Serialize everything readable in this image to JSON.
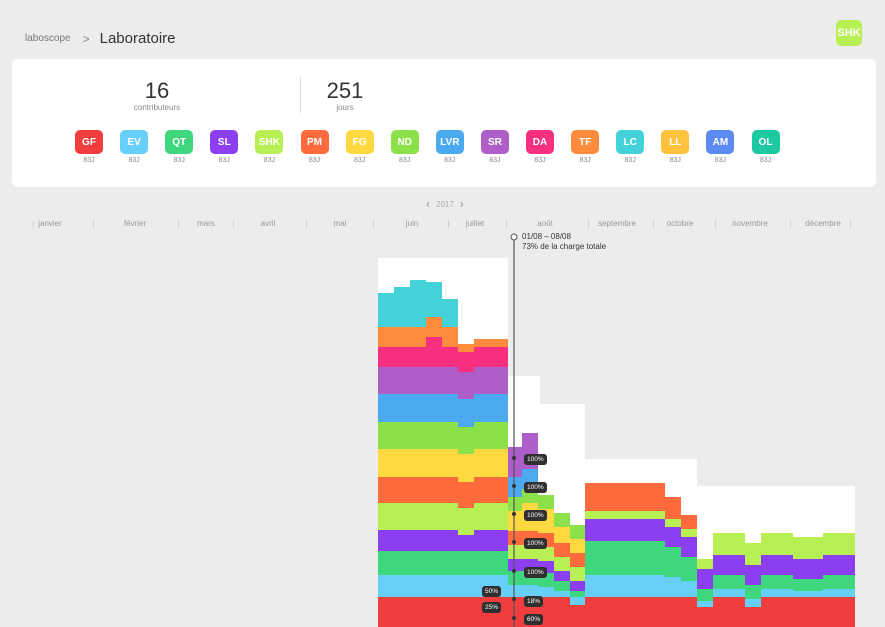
{
  "breadcrumb": {
    "root": "laboscope",
    "separator": ">",
    "current": "Laboratoire"
  },
  "user": {
    "initials": "SHK",
    "color": "#b8ef55"
  },
  "stats": [
    {
      "value": "16",
      "label": "contributeurs"
    },
    {
      "value": "251",
      "label": "jours"
    }
  ],
  "contributors": [
    {
      "initials": "GF",
      "days": "83J",
      "color": "#f03e3e"
    },
    {
      "initials": "EV",
      "days": "83J",
      "color": "#66d0fa"
    },
    {
      "initials": "QT",
      "days": "83J",
      "color": "#3fd77e"
    },
    {
      "initials": "SL",
      "days": "83J",
      "color": "#8b3ff0"
    },
    {
      "initials": "SHK",
      "days": "83J",
      "color": "#b8ef55"
    },
    {
      "initials": "PM",
      "days": "83J",
      "color": "#ff6b3d"
    },
    {
      "initials": "FG",
      "days": "83J",
      "color": "#ffd93f"
    },
    {
      "initials": "ND",
      "days": "83J",
      "color": "#8ce04a"
    },
    {
      "initials": "LVR",
      "days": "83J",
      "color": "#4aa9ef"
    },
    {
      "initials": "SR",
      "days": "83J",
      "color": "#ad5ec9"
    },
    {
      "initials": "DA",
      "days": "83J",
      "color": "#f72f80"
    },
    {
      "initials": "TF",
      "days": "83J",
      "color": "#ff8b3d"
    },
    {
      "initials": "LC",
      "days": "83J",
      "color": "#42d2d7"
    },
    {
      "initials": "LL",
      "days": "83J",
      "color": "#ffc23f"
    },
    {
      "initials": "AM",
      "days": "83J",
      "color": "#5b8bf2"
    },
    {
      "initials": "OL",
      "days": "83J",
      "color": "#1cc9a0"
    }
  ],
  "year_nav": {
    "year": "2017"
  },
  "months": [
    "janvier",
    "février",
    "mars",
    "avril",
    "mai",
    "juin",
    "juillet",
    "août",
    "septembre",
    "octobre",
    "novembre",
    "décembre"
  ],
  "selection": {
    "range": "01/08 – 08/08",
    "summary": "73% de la charge totale"
  },
  "chart_data": {
    "type": "area",
    "x": [
      "mai",
      "juin",
      "juillet",
      "août",
      "septembre",
      "octobre",
      "novembre",
      "décembre"
    ],
    "series_order": [
      "GF",
      "EV",
      "QT",
      "SL",
      "SHK",
      "PM",
      "FG",
      "ND",
      "LVR",
      "SR",
      "DA",
      "TF",
      "LC"
    ],
    "columns": [
      {
        "week": 1,
        "layers": [
          10,
          7,
          10,
          8,
          15,
          10,
          10,
          10,
          10,
          10,
          7,
          8,
          3,
          8
        ]
      },
      {
        "week": 2,
        "layers": [
          10,
          7,
          10,
          8,
          15,
          10,
          10,
          10,
          10,
          10,
          7,
          8,
          5,
          8
        ]
      },
      {
        "week": 3,
        "layers": [
          10,
          7,
          10,
          8,
          15,
          10,
          10,
          10,
          10,
          10,
          7,
          8,
          8,
          8
        ]
      },
      {
        "week": 4,
        "layers": [
          10,
          5,
          10,
          5,
          15,
          10,
          10,
          8,
          10,
          10,
          7,
          7,
          10,
          6
        ]
      },
      {
        "week": 5,
        "layers": [
          10,
          7,
          10,
          8,
          15,
          10,
          10,
          10,
          10,
          10,
          7,
          8,
          8,
          6
        ]
      },
      {
        "week": 6,
        "layers": [
          10,
          7,
          10,
          8,
          15,
          10,
          10,
          10,
          10,
          10,
          7,
          8,
          6,
          6
        ]
      },
      {
        "week": 7,
        "layers": [
          10,
          7,
          10,
          8,
          12,
          10,
          10,
          10,
          10,
          10,
          5,
          0,
          0,
          0
        ]
      },
      {
        "week": 8,
        "layers": [
          10,
          7,
          10,
          8,
          12,
          10,
          10,
          10,
          10,
          10,
          7,
          0,
          0,
          0
        ]
      },
      {
        "week": 9,
        "layers": [
          10,
          7,
          10,
          8,
          12,
          10,
          10,
          10,
          10,
          10,
          7,
          5,
          0,
          0
        ]
      }
    ],
    "markers": [
      "100%",
      "100%",
      "100%",
      "100%",
      "100%",
      "50%",
      "18%",
      "25%",
      "60%"
    ]
  }
}
